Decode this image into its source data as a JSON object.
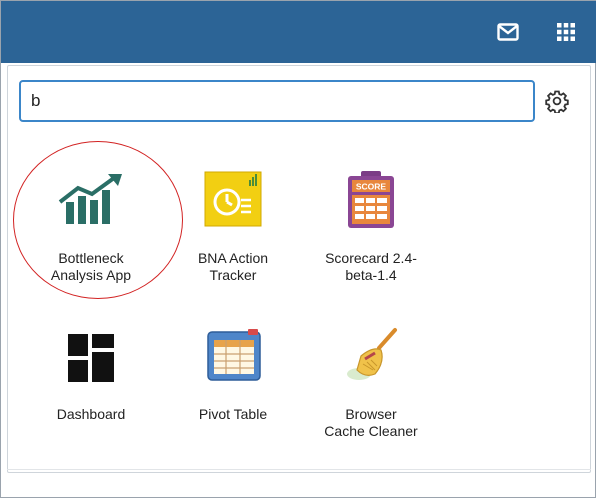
{
  "header": {
    "mail_icon": "mail-icon",
    "apps_icon": "app-grid-icon",
    "background": "#2c6496"
  },
  "search": {
    "value": "b",
    "placeholder": "",
    "focus_color": "#3b86c9",
    "settings_icon": "gear-icon"
  },
  "apps": [
    {
      "label_line1": "Bottleneck",
      "label_line2": "Analysis App",
      "icon": "trend-chart-icon"
    },
    {
      "label_line1": "BNA Action",
      "label_line2": "Tracker",
      "icon": "bna-action-tracker-icon"
    },
    {
      "label_line1": "Scorecard 2.4-",
      "label_line2": "beta-1.4",
      "icon": "scorecard-icon"
    },
    {
      "label_line1": "Dashboard",
      "label_line2": "",
      "icon": "dashboard-icon"
    },
    {
      "label_line1": "Pivot Table",
      "label_line2": "",
      "icon": "pivot-table-icon"
    },
    {
      "label_line1": "Browser",
      "label_line2": "Cache Cleaner",
      "icon": "broom-icon"
    }
  ],
  "annotation": {
    "color": "#d22222",
    "target": "Bottleneck Analysis App"
  }
}
